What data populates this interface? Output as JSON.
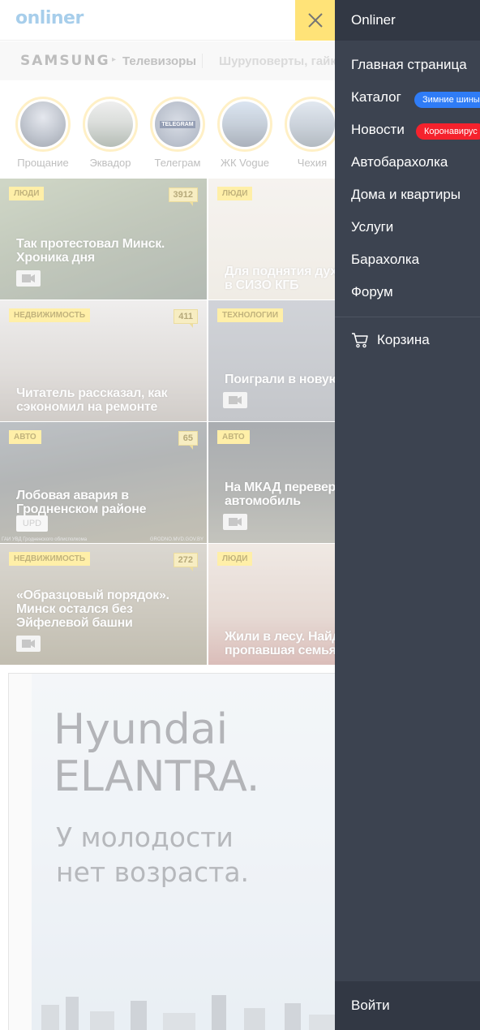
{
  "header": {
    "logo_text": "onliner",
    "close_icon": "close-x-icon"
  },
  "brandbar": {
    "brand": "SAMSUNG",
    "category": "Телевизоры",
    "promo_text": "Шуруповерты, гайковерты"
  },
  "stories": [
    {
      "label": "Прощание"
    },
    {
      "label": "Эквадор"
    },
    {
      "label": "Телеграм",
      "badge_text": "TELEGRAM"
    },
    {
      "label": "ЖК Vogue"
    },
    {
      "label": "Чехия"
    }
  ],
  "tiles": [
    {
      "rubric": "ЛЮДИ",
      "counter": "3912",
      "title": "Так протестовал Минск. Хроника дня",
      "media": "video-camera-icon"
    },
    {
      "rubric": "ЛЮДИ",
      "counter": "",
      "title": "Для поднятия духа мемами в СИЗО КГБ",
      "media": ""
    },
    {
      "rubric": "НЕДВИЖИМОСТЬ",
      "counter": "411",
      "title": "Читатель рассказал, как сэкономил на ремонте",
      "media": ""
    },
    {
      "rubric": "ТЕХНОЛОГИИ",
      "counter": "",
      "title": "Поиграли в новую CoD",
      "media": "video-camera-icon"
    },
    {
      "rubric": "АВТО",
      "counter": "65",
      "title": "Лобовая авария в Гродненском районе",
      "media": "UPD",
      "caption_left": "ГАИ УВД Гродненского облисполкома",
      "caption_right": "GRODNO.MVD.GOV.BY"
    },
    {
      "rubric": "АВТО",
      "counter": "",
      "title": "На МКАД перевернулся автомобиль",
      "media": "video-camera-icon"
    },
    {
      "rubric": "НЕДВИЖИМОСТЬ",
      "counter": "272",
      "title": "«Образцовый порядок». Минск остался без Эйфелевой башни",
      "media": "video-camera-icon"
    },
    {
      "rubric": "ЛЮДИ",
      "counter": "",
      "title": "Жили в лесу. Найдена пропавшая семья",
      "media": ""
    }
  ],
  "ad": {
    "brand_line1": "Hyundai",
    "brand_line2": "ELANTRA.",
    "slogan_line1": "У молодости",
    "slogan_line2": "нет возраста."
  },
  "menu": {
    "title": "Onliner",
    "items": [
      {
        "label": "Главная страница"
      },
      {
        "label": "Каталог",
        "badge": "Зимние шины",
        "badge_color": "#2f7cf6"
      },
      {
        "label": "Новости",
        "badge": "Коронавирус",
        "badge_color": "#f5222d"
      },
      {
        "label": "Автобарахолка"
      },
      {
        "label": "Дома и квартиры"
      },
      {
        "label": "Услуги"
      },
      {
        "label": "Барахолка"
      },
      {
        "label": "Форум"
      }
    ],
    "cart_label": "Корзина",
    "cart_icon": "cart-icon",
    "login_label": "Войти"
  },
  "colors": {
    "accent_yellow": "#ffd530",
    "menu_bg": "#3c4350",
    "menu_header_bg": "#323844",
    "logo_blue": "#78b4e0"
  }
}
